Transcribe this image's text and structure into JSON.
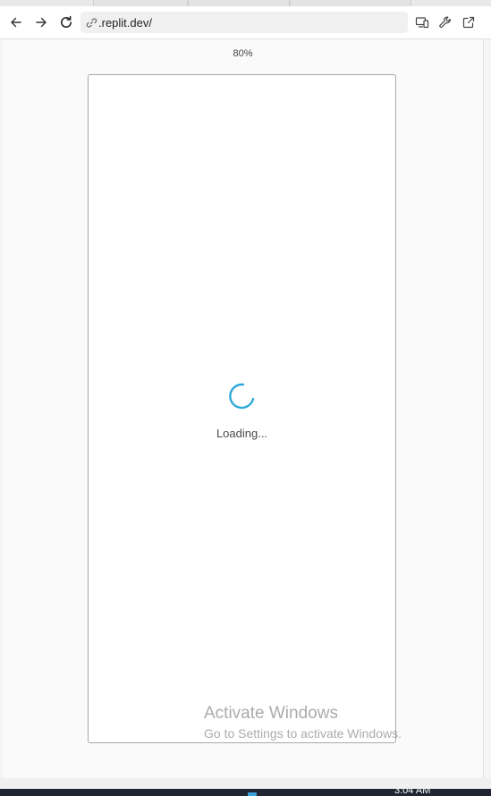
{
  "browser": {
    "url": ".replit.dev/",
    "nav_icons": [
      "back-arrow-icon",
      "forward-arrow-icon",
      "reload-icon",
      "link-icon"
    ],
    "action_icons": [
      "devices-icon",
      "wrench-icon",
      "open-external-icon"
    ]
  },
  "preview": {
    "zoom": "80%",
    "loading_text": "Loading...",
    "spinner_color": "#2fa9d9"
  },
  "watermark": {
    "title": "Activate Windows",
    "subtitle": "Go to Settings to activate Windows."
  },
  "taskbar": {
    "clock": "3:04 AM"
  }
}
